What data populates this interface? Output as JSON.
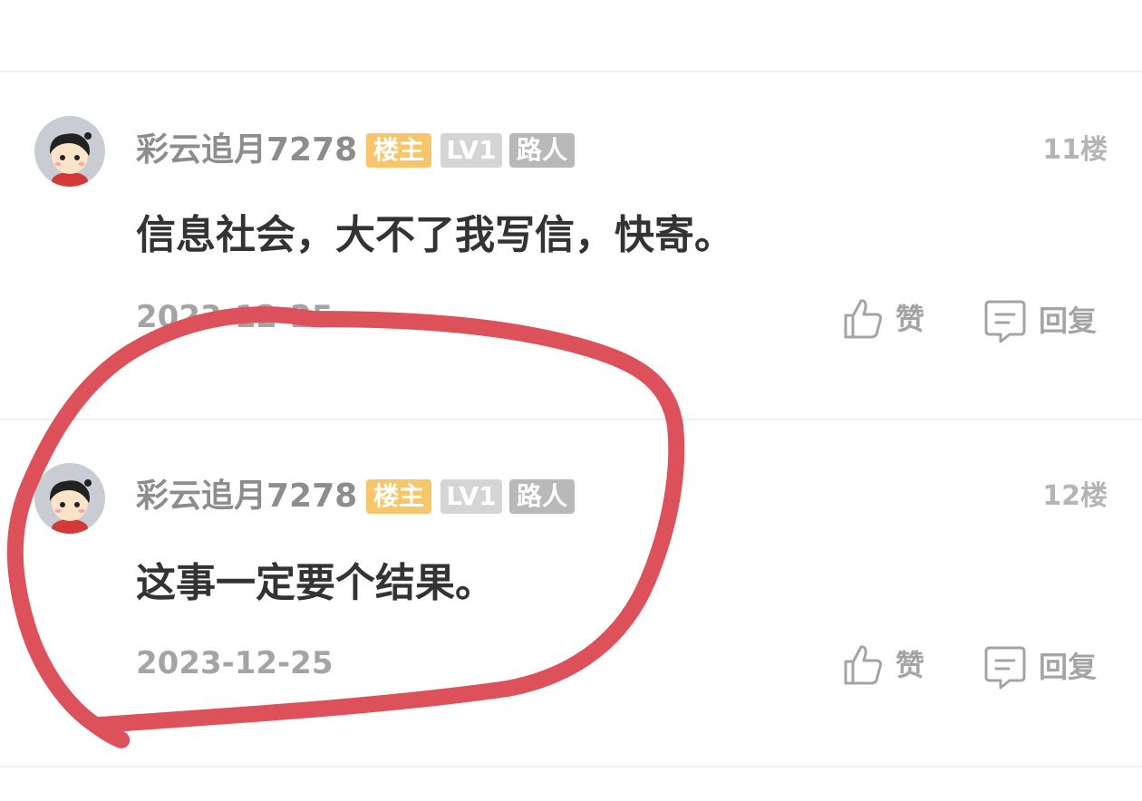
{
  "comments": [
    {
      "username": "彩云追月7278",
      "badge_host": "楼主",
      "badge_level": "LV1",
      "badge_role": "路人",
      "floor": "11楼",
      "content": "信息社会，大不了我写信，快寄。",
      "date": "2023-12-25",
      "like_label": "赞",
      "reply_label": "回复"
    },
    {
      "username": "彩云追月7278",
      "badge_host": "楼主",
      "badge_level": "LV1",
      "badge_role": "路人",
      "floor": "12楼",
      "content": "这事一定要个结果。",
      "date": "2023-12-25",
      "like_label": "赞",
      "reply_label": "回复"
    }
  ],
  "colors": {
    "host_badge": "#f7c66a",
    "level_badge": "#d5d5d5",
    "role_badge": "#b9b9b9",
    "annotation_stroke": "#dd525a"
  },
  "icons": {
    "like": "thumbs-up-icon",
    "reply": "speech-bubble-icon"
  }
}
